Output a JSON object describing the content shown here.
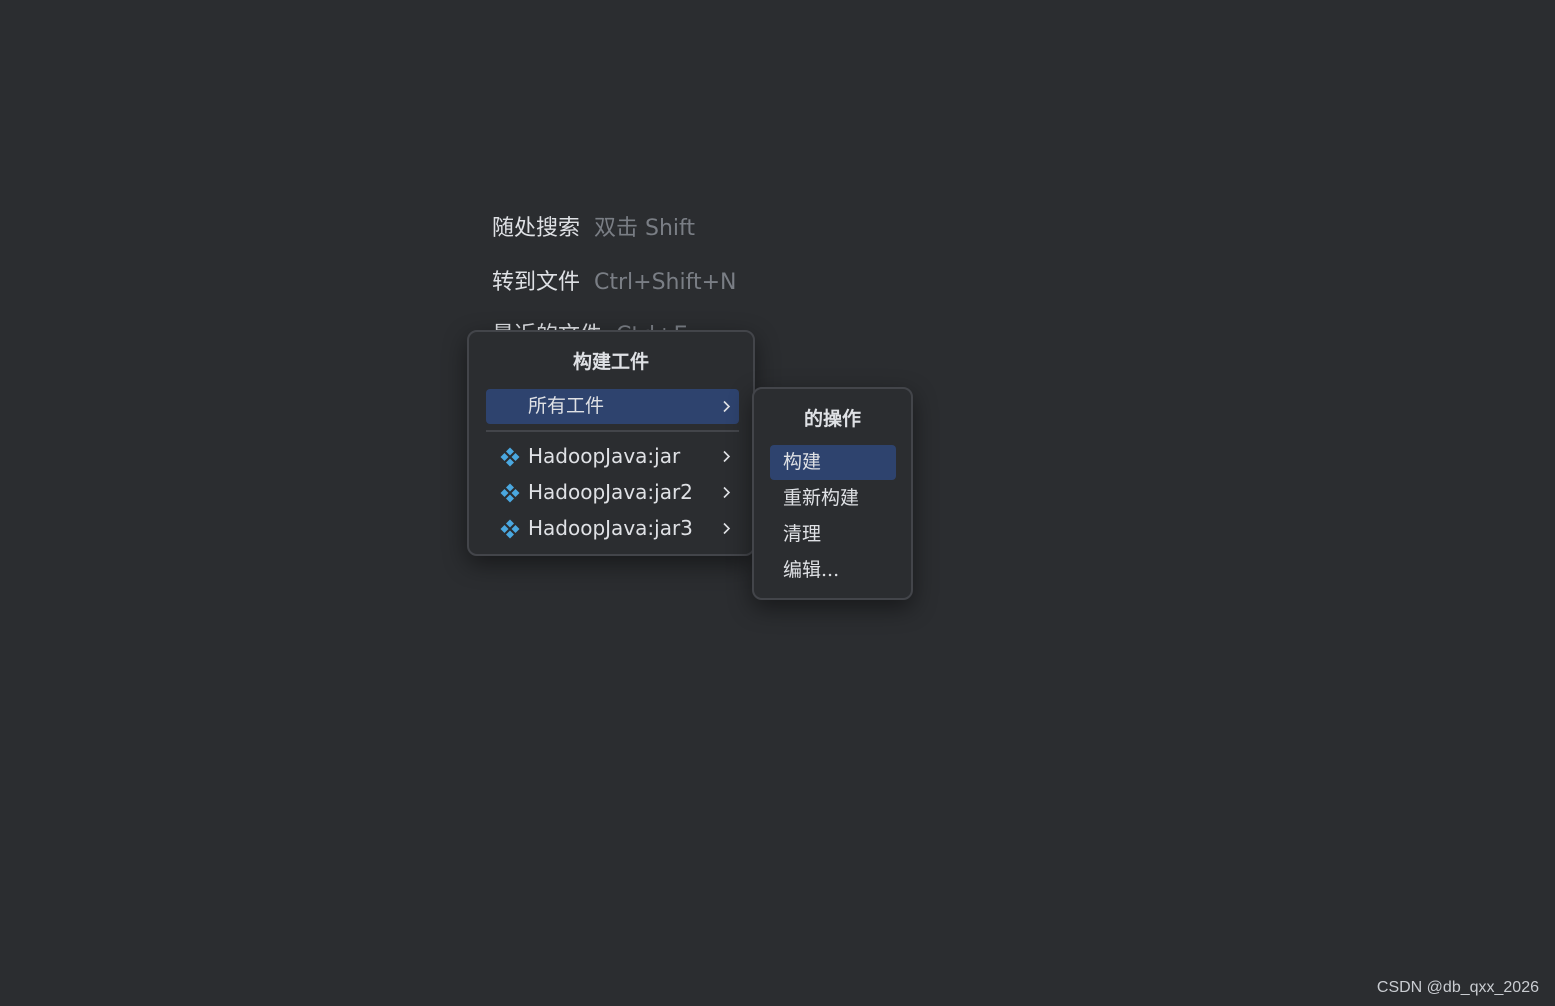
{
  "hints": [
    {
      "label": "随处搜索",
      "shortcut": "双击 Shift"
    },
    {
      "label": "转到文件",
      "shortcut": "Ctrl+Shift+N"
    },
    {
      "label": "最近的文件",
      "shortcut": "Ctrl+E"
    }
  ],
  "build_popup": {
    "title": "构建工件",
    "all_artifacts": "所有工件",
    "artifacts": [
      "HadoopJava:jar",
      "HadoopJava:jar2",
      "HadoopJava:jar3"
    ]
  },
  "actions_popup": {
    "title": "的操作",
    "items": [
      "构建",
      "重新构建",
      "清理",
      "编辑..."
    ],
    "selected_index": 0
  },
  "watermark": "CSDN @db_qxx_2026",
  "colors": {
    "background": "#2b2d30",
    "selection": "#2e436e",
    "artifact_icon": "#4aa8e0"
  },
  "icons": {
    "artifact": "artifact-diamond-icon",
    "submenu": "chevron-right-icon"
  }
}
